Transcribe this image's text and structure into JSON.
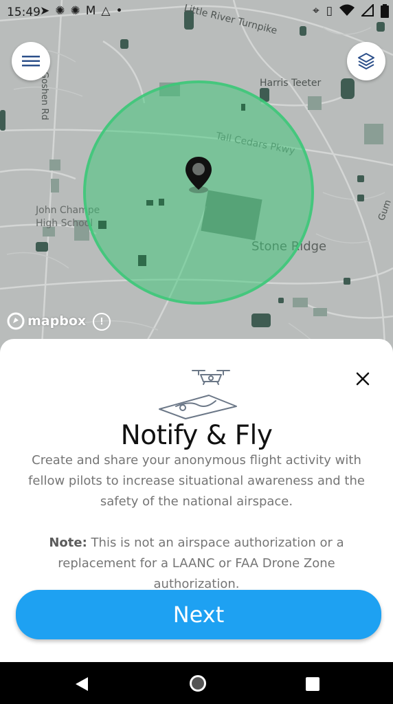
{
  "status_bar": {
    "time": "15:49",
    "left_icons": [
      "navigation-icon",
      "settings-icon",
      "settings-icon",
      "gmail-icon",
      "drive-icon",
      "dot-icon"
    ],
    "right_icons": [
      "location-icon",
      "vibrate-icon",
      "wifi-icon",
      "signal-icon",
      "battery-icon"
    ]
  },
  "map": {
    "labels": {
      "harris_teeter": "Harris Teeter",
      "little_river": "Little River Turnpike",
      "goshen": "Goshen Rd",
      "tall_cedars": "Tall Cedars Pkwy",
      "john_champe_line1": "John Champe",
      "john_champe_line2": "High School",
      "stone_ridge": "Stone Ridge",
      "gum": "Gum"
    },
    "attribution": "mapbox",
    "geofence_color": "#3cc878"
  },
  "sheet": {
    "title": "Notify & Fly",
    "description": "Create and share your anonymous flight activity with fellow pilots to increase situational awareness and the safety of the national airspace.",
    "note_label": "Note:",
    "note_text": " This is not an airspace authorization or a replacement for a LAANC or FAA Drone Zone authorization.",
    "next_label": "Next",
    "accent_color": "#1ea1f2"
  }
}
